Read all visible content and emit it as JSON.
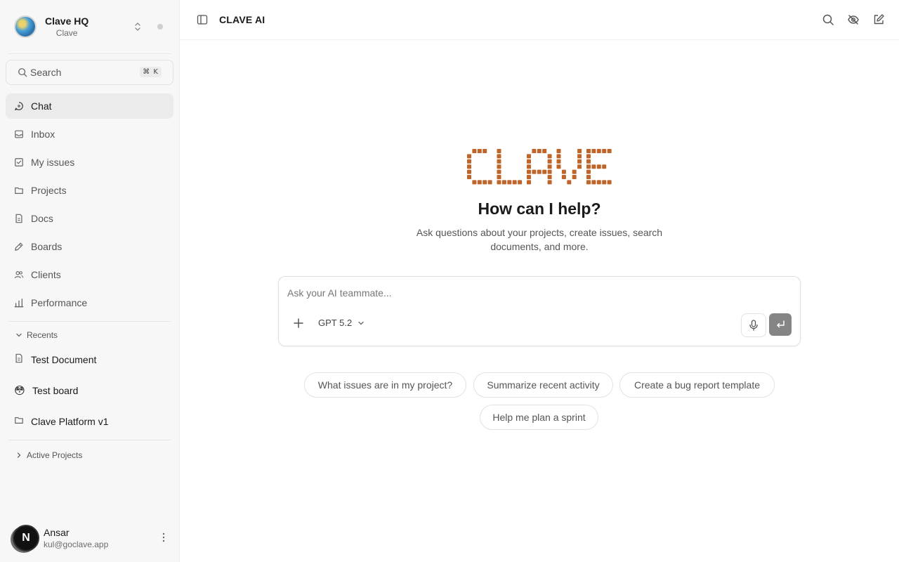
{
  "workspace": {
    "name": "Clave HQ",
    "subtitle": "Clave"
  },
  "search": {
    "label": "Search",
    "shortcut": "⌘ K"
  },
  "nav": [
    {
      "label": "Chat",
      "icon": "chat-icon",
      "active": true
    },
    {
      "label": "Inbox",
      "icon": "inbox-icon"
    },
    {
      "label": "My issues",
      "icon": "checkbox-icon"
    },
    {
      "label": "Projects",
      "icon": "folder-icon"
    },
    {
      "label": "Docs",
      "icon": "document-icon"
    },
    {
      "label": "Boards",
      "icon": "pen-icon"
    },
    {
      "label": "Clients",
      "icon": "users-icon"
    },
    {
      "label": "Performance",
      "icon": "bar-chart-icon"
    }
  ],
  "recents": {
    "title": "Recents",
    "items": [
      {
        "label": "Test Document",
        "icon": "document-icon"
      },
      {
        "label": "Test board",
        "icon": "emoji-face-icon",
        "emoji": "😳"
      },
      {
        "label": "Clave Platform v1",
        "icon": "folder-icon"
      }
    ]
  },
  "active_projects": {
    "title": "Active Projects"
  },
  "user": {
    "avatar_letter": "N",
    "name": "Ansar",
    "email": "kul@goclave.app"
  },
  "topbar": {
    "title": "CLAVE AI"
  },
  "hero": {
    "logo_text": "CLAVE",
    "title": "How can I help?",
    "subtitle": "Ask questions about your projects, create issues, search documents, and more.",
    "accent_color": "#c0652a"
  },
  "composer": {
    "placeholder": "Ask your AI teammate...",
    "model": "GPT 5.2"
  },
  "suggestions": [
    "What issues are in my project?",
    "Summarize recent activity",
    "Create a bug report template",
    "Help me plan a sprint"
  ]
}
